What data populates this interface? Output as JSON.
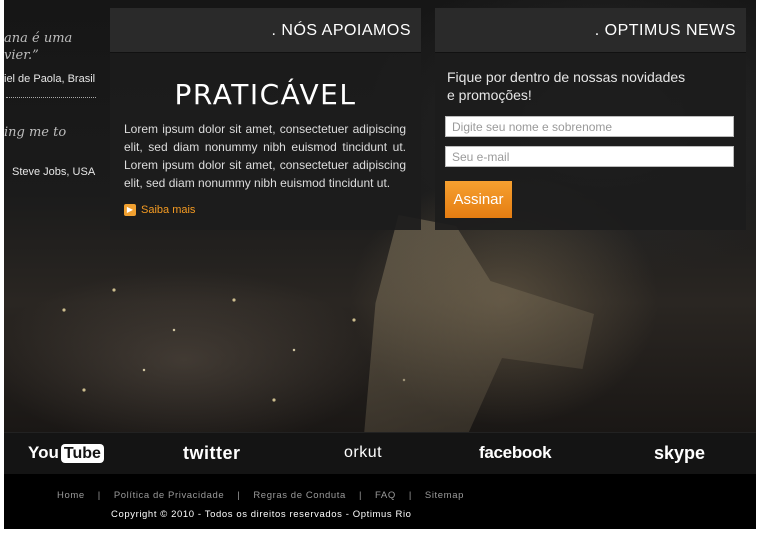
{
  "quotes": [
    {
      "text": "ana é uma",
      "text2": "vier.”",
      "author": "iel de Paola, Brasil"
    },
    {
      "text": "ing me to",
      "author": "Steve Jobs, USA"
    }
  ],
  "support": {
    "title": ". NÓS APOIAMOS",
    "headline": "PRATICÁVEL",
    "body": "Lorem ipsum dolor sit amet, consectetuer adipiscing elit, sed diam nonummy nibh euismod tincidunt ut. Lorem ipsum dolor sit amet, consectetuer adipiscing elit, sed diam nonummy nibh euismod tincidunt ut.",
    "more_label": "Saiba mais"
  },
  "news": {
    "title": ". OPTIMUS NEWS",
    "intro_line1": "Fique por dentro de nossas novidades",
    "intro_line2": "e promoções!",
    "name_placeholder": "Digite seu nome e sobrenome",
    "email_placeholder": "Seu e-mail",
    "button_label": "Assinar"
  },
  "social": {
    "youtube_a": "You",
    "youtube_b": "Tube",
    "twitter": "twitter",
    "orkut": "orkut",
    "facebook": "facebook",
    "skype": "skype"
  },
  "footer": {
    "nav": [
      "Home",
      "Política de Privacidade",
      "Regras de Conduta",
      "FAQ",
      "Sitemap"
    ],
    "copyright": "Copyright © 2010 - Todos os direitos reservados - Optimus Rio"
  },
  "colors": {
    "accent": "#f39a22",
    "panel_bg": "#1c1c1c",
    "header_bg": "#2a2a2a"
  }
}
